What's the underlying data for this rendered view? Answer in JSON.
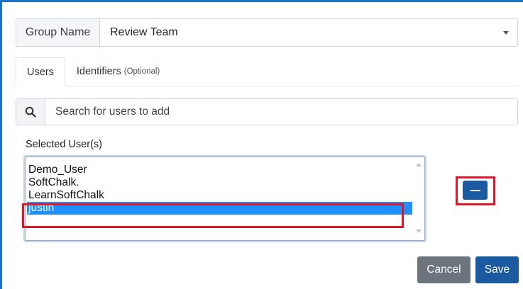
{
  "group": {
    "label": "Group Name",
    "value": "Review Team"
  },
  "tabs": [
    {
      "label": "Users",
      "optional": ""
    },
    {
      "label": "Identifiers",
      "optional": "(Optional)"
    }
  ],
  "search": {
    "placeholder": "Search for users to add"
  },
  "selected_users": {
    "label": "Selected User(s)",
    "items": [
      "Demo_User",
      "SoftChalk.",
      "LearnSoftChalk",
      "justin"
    ],
    "selected_index": 3
  },
  "footer": {
    "cancel_label": "Cancel",
    "save_label": "Save"
  },
  "colors": {
    "primary": "#1b5aa0",
    "secondary": "#6c757d",
    "selection": "#1e90ff",
    "highlight": "#e0162a"
  },
  "icons": {
    "search": "search-icon",
    "dropdown": "chevron-down-icon",
    "remove": "minus-icon"
  }
}
